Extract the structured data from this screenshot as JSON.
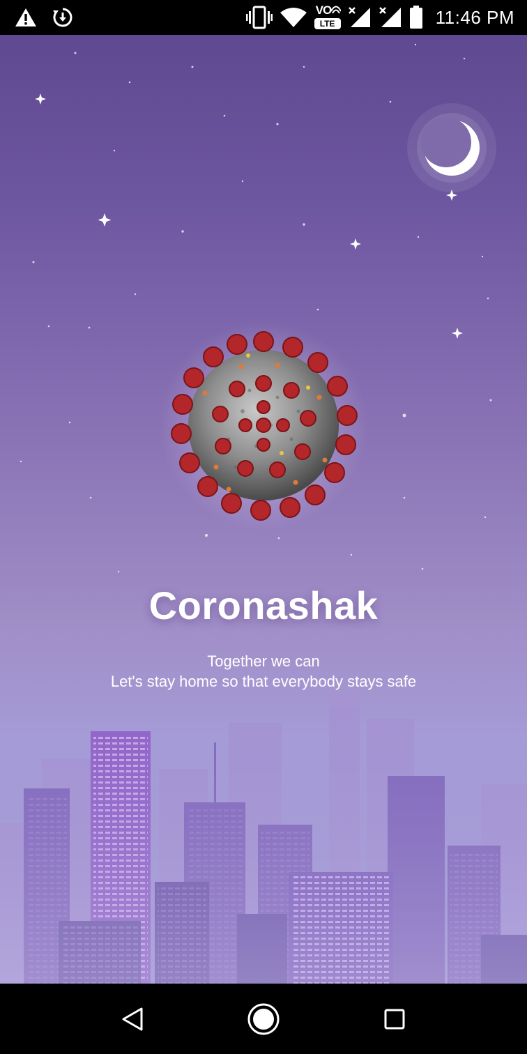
{
  "status_bar": {
    "time": "11:46 PM",
    "network_badge": "LTE",
    "volte_label": "VO",
    "icons": [
      "warning-icon",
      "sync-icon",
      "vibrate-icon",
      "wifi-icon",
      "volte-icon",
      "signal-icon",
      "signal-icon",
      "battery-icon"
    ]
  },
  "splash": {
    "title": "Coronashak",
    "tagline_line1": "Together we can",
    "tagline_line2": "Let's stay home so that everybody stays safe",
    "images": [
      "moon-icon",
      "coronavirus-illustration",
      "city-skyline"
    ]
  },
  "colors": {
    "sky_top": "#5f4990",
    "sky_bottom": "#a59bd6",
    "building_light": "#b48de0",
    "building_dark": "#6a54a6",
    "virus_spike": "#b3262a"
  },
  "nav_bar": {
    "icons": [
      "back-icon",
      "home-icon",
      "recents-icon"
    ]
  }
}
